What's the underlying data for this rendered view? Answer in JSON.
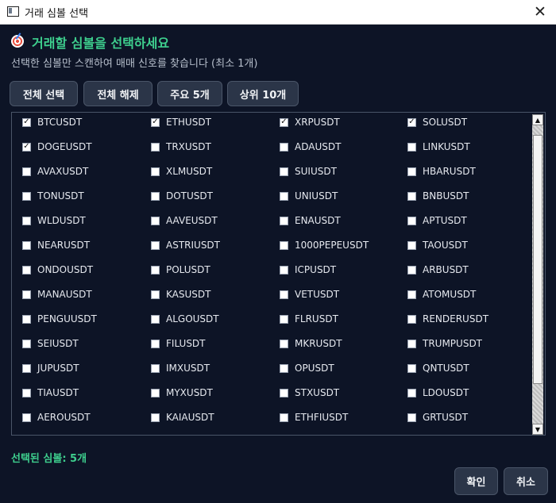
{
  "window": {
    "title": "거래 심볼 선택",
    "close_label": "✕"
  },
  "header": {
    "title": "거래할 심볼을 선택하세요",
    "subtitle": "선택한 심볼만 스캔하여 매매 신호를 찾습니다 (최소 1개)"
  },
  "toolbar": {
    "select_all": "전체 선택",
    "deselect_all": "전체 해제",
    "major5": "주요 5개",
    "top10": "상위 10개"
  },
  "symbols": [
    {
      "name": "BTCUSDT",
      "checked": true
    },
    {
      "name": "ETHUSDT",
      "checked": true
    },
    {
      "name": "XRPUSDT",
      "checked": true
    },
    {
      "name": "SOLUSDT",
      "checked": true
    },
    {
      "name": "DOGEUSDT",
      "checked": true
    },
    {
      "name": "TRXUSDT",
      "checked": false
    },
    {
      "name": "ADAUSDT",
      "checked": false
    },
    {
      "name": "LINKUSDT",
      "checked": false
    },
    {
      "name": "AVAXUSDT",
      "checked": false
    },
    {
      "name": "XLMUSDT",
      "checked": false
    },
    {
      "name": "SUIUSDT",
      "checked": false
    },
    {
      "name": "HBARUSDT",
      "checked": false
    },
    {
      "name": "TONUSDT",
      "checked": false
    },
    {
      "name": "DOTUSDT",
      "checked": false
    },
    {
      "name": "UNIUSDT",
      "checked": false
    },
    {
      "name": "BNBUSDT",
      "checked": false
    },
    {
      "name": "WLDUSDT",
      "checked": false
    },
    {
      "name": "AAVEUSDT",
      "checked": false
    },
    {
      "name": "ENAUSDT",
      "checked": false
    },
    {
      "name": "APTUSDT",
      "checked": false
    },
    {
      "name": "NEARUSDT",
      "checked": false
    },
    {
      "name": "ASTRIUSDT",
      "checked": false
    },
    {
      "name": "1000PEPEUSDT",
      "checked": false
    },
    {
      "name": "TAOUSDT",
      "checked": false
    },
    {
      "name": "ONDOUSDT",
      "checked": false
    },
    {
      "name": "POLUSDT",
      "checked": false
    },
    {
      "name": "ICPUSDT",
      "checked": false
    },
    {
      "name": "ARBUSDT",
      "checked": false
    },
    {
      "name": "MANAUSDT",
      "checked": false
    },
    {
      "name": "KASUSDT",
      "checked": false
    },
    {
      "name": "VETUSDT",
      "checked": false
    },
    {
      "name": "ATOMUSDT",
      "checked": false
    },
    {
      "name": "PENGUUSDT",
      "checked": false
    },
    {
      "name": "ALGOUSDT",
      "checked": false
    },
    {
      "name": "FLRUSDT",
      "checked": false
    },
    {
      "name": "RENDERUSDT",
      "checked": false
    },
    {
      "name": "SEIUSDT",
      "checked": false
    },
    {
      "name": "FILUSDT",
      "checked": false
    },
    {
      "name": "MKRUSDT",
      "checked": false
    },
    {
      "name": "TRUMPUSDT",
      "checked": false
    },
    {
      "name": "JUPUSDT",
      "checked": false
    },
    {
      "name": "IMXUSDT",
      "checked": false
    },
    {
      "name": "OPUSDT",
      "checked": false
    },
    {
      "name": "QNTUSDT",
      "checked": false
    },
    {
      "name": "TIAUSDT",
      "checked": false
    },
    {
      "name": "MYXUSDT",
      "checked": false
    },
    {
      "name": "STXUSDT",
      "checked": false
    },
    {
      "name": "LDOUSDT",
      "checked": false
    },
    {
      "name": "AEROUSDT",
      "checked": false
    },
    {
      "name": "KAIAUSDT",
      "checked": false
    },
    {
      "name": "ETHFIUSDT",
      "checked": false
    },
    {
      "name": "GRTUSDT",
      "checked": false
    }
  ],
  "status": {
    "selected_text": "선택된 심볼: 5개"
  },
  "footer": {
    "confirm": "확인",
    "cancel": "취소"
  },
  "colors": {
    "background": "#0d1426",
    "accent": "#3ecf8e",
    "button": "#2b3548"
  }
}
